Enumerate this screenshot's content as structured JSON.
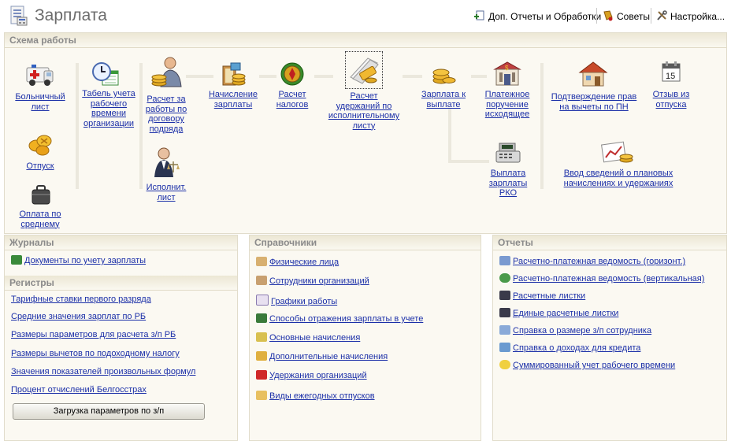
{
  "header": {
    "title": "Зарплата",
    "reports_link": "Доп. Отчеты и Обработки",
    "tips_link": "Советы",
    "settings_link": "Настройка..."
  },
  "scheme": {
    "title": "Схема работы",
    "nodes": {
      "sick": "Больничный лист",
      "vacation": "Отпуск",
      "avg_pay": "Оплата по среднему",
      "timesheet": "Табель учета рабочего времени организации",
      "contract_calc": "Расчет за работы по договору подряда",
      "writ": "Исполнит. лист",
      "accrual": "Начисление зарплаты",
      "taxes": "Расчет налогов",
      "writ_deductions": "Расчет удержаний по исполнительному листу",
      "payout": "Зарплата к выплате",
      "payment_order": "Платежное поручение исходящее",
      "cash_payout": "Выплата зарплаты РКО",
      "tax_deductions_confirm": "Подтверждение прав на вычеты по ПН",
      "recall": "Отзыв из отпуска",
      "planned_accruals": "Ввод сведений о плановых начислениях и удержаниях"
    }
  },
  "journals": {
    "title": "Журналы",
    "items": [
      "Документы по учету зарплаты"
    ]
  },
  "registers": {
    "title": "Регистры",
    "items": [
      "Тарифные ставки первого разряда",
      "Средние значения зарплат по РБ",
      "Размеры параметров для расчета з/п РБ",
      "Размеры вычетов по подоходному налогу",
      "Значения показателей произвольных формул",
      "Процент отчислений Белгосстрах"
    ],
    "load_button": "Загрузка параметров по з/п"
  },
  "references": {
    "title": "Справочники",
    "items": [
      "Физические лица",
      "Сотрудники организаций",
      "Графики работы",
      "Способы отражения зарплаты в учете",
      "Основные начисления",
      "Дополнительные начисления",
      "Удержания организаций",
      "Виды ежегодных отпусков"
    ]
  },
  "reports": {
    "title": "Отчеты",
    "items": [
      "Расчетно-платежная ведомость (горизонт.)",
      "Расчетно-платежная ведомость (вертикальная)",
      "Расчетные листки",
      "Единые расчетные листки",
      "Справка о размере з/п сотрудника",
      "Справка о доходах для кредита",
      "Суммированный учет рабочего времени"
    ]
  },
  "icons": {
    "app": "payroll-document-icon",
    "reports": "add-report-icon",
    "tips": "tips-icon",
    "settings": "tools-icon"
  }
}
